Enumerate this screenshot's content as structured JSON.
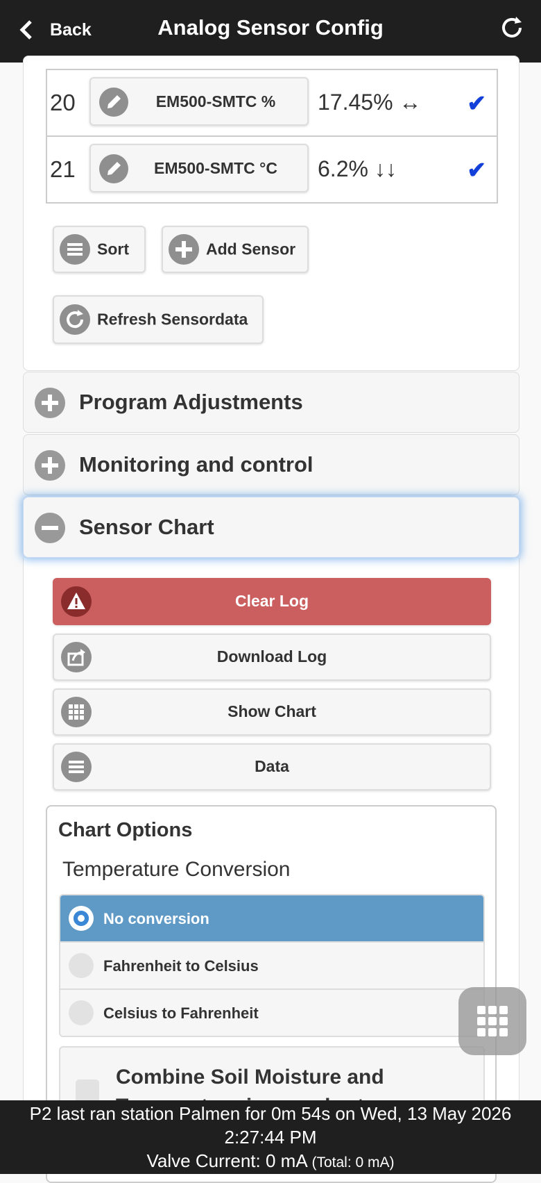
{
  "header": {
    "back_label": "Back",
    "title": "Analog Sensor Config"
  },
  "sensors": [
    {
      "num": "20",
      "name": "EM500-SMTC %",
      "value": "17.45% ↔",
      "check": "✔"
    },
    {
      "num": "21",
      "name": "EM500-SMTC °C",
      "value": "6.2% ↓↓",
      "check": "✔"
    }
  ],
  "actions": {
    "sort": "Sort",
    "add_sensor": "Add Sensor",
    "refresh": "Refresh Sensordata"
  },
  "sections": {
    "program": "Program Adjustments",
    "monitoring": "Monitoring and control",
    "chart": "Sensor Chart"
  },
  "chart_buttons": {
    "clear": "Clear Log",
    "download": "Download Log",
    "show": "Show Chart",
    "data": "Data"
  },
  "chart_options": {
    "title": "Chart Options",
    "temp_label": "Temperature Conversion",
    "radios": [
      "No conversion",
      "Fahrenheit to Celsius",
      "Celsius to Fahrenheit"
    ],
    "selected_index": 0,
    "combine": "Combine Soil Moisture and Temperature in one chart"
  },
  "footer": {
    "line1": "P2 last ran station Palmen for 0m 54s on Wed, 13 May 2026",
    "line2": "2:27:44 PM",
    "valve": "Valve Current: 0 mA",
    "total": "(Total: 0 mA)"
  },
  "colors": {
    "header_bg": "#1f1f1f",
    "danger": "#cb5f5f",
    "selected": "#5f9ac7",
    "check": "#1240d9"
  }
}
